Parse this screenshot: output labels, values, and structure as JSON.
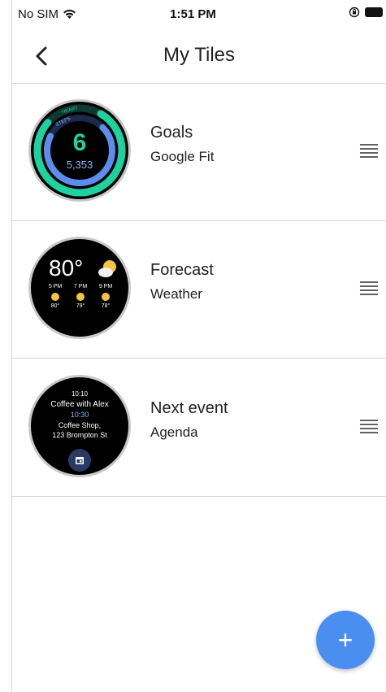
{
  "status_bar": {
    "carrier": "No SIM",
    "time": "1:51 PM"
  },
  "header": {
    "title": "My Tiles"
  },
  "tiles": [
    {
      "name": "Goals",
      "app": "Google Fit",
      "preview": {
        "label_outer": "HEART",
        "label_inner": "STEPS",
        "value": "6",
        "sub": "5,353"
      }
    },
    {
      "name": "Forecast",
      "app": "Weather",
      "preview": {
        "current_temp": "80°",
        "hours": [
          {
            "time": "5 PM",
            "temp": "80°"
          },
          {
            "time": "7 PM",
            "temp": "79°"
          },
          {
            "time": "9 PM",
            "temp": "78°"
          }
        ]
      }
    },
    {
      "name": "Next event",
      "app": "Agenda",
      "preview": {
        "time_now": "10:10",
        "event": "Coffee with Alex",
        "event_time": "10:30",
        "location_1": "Coffee Shop,",
        "location_2": "123 Brompton St"
      }
    }
  ],
  "fab": {
    "label": "+"
  },
  "colors": {
    "accent": "#4a8ef0",
    "fit_green": "#1ed1a0",
    "fit_blue": "#5b8def",
    "sun": "#f6c343"
  },
  "icons": [
    "wifi-icon",
    "orientation-lock-icon",
    "battery-icon",
    "back-chevron-icon",
    "drag-handle-icon",
    "calendar-icon",
    "sun-cloud-icon",
    "heart-icon",
    "steps-icon"
  ]
}
